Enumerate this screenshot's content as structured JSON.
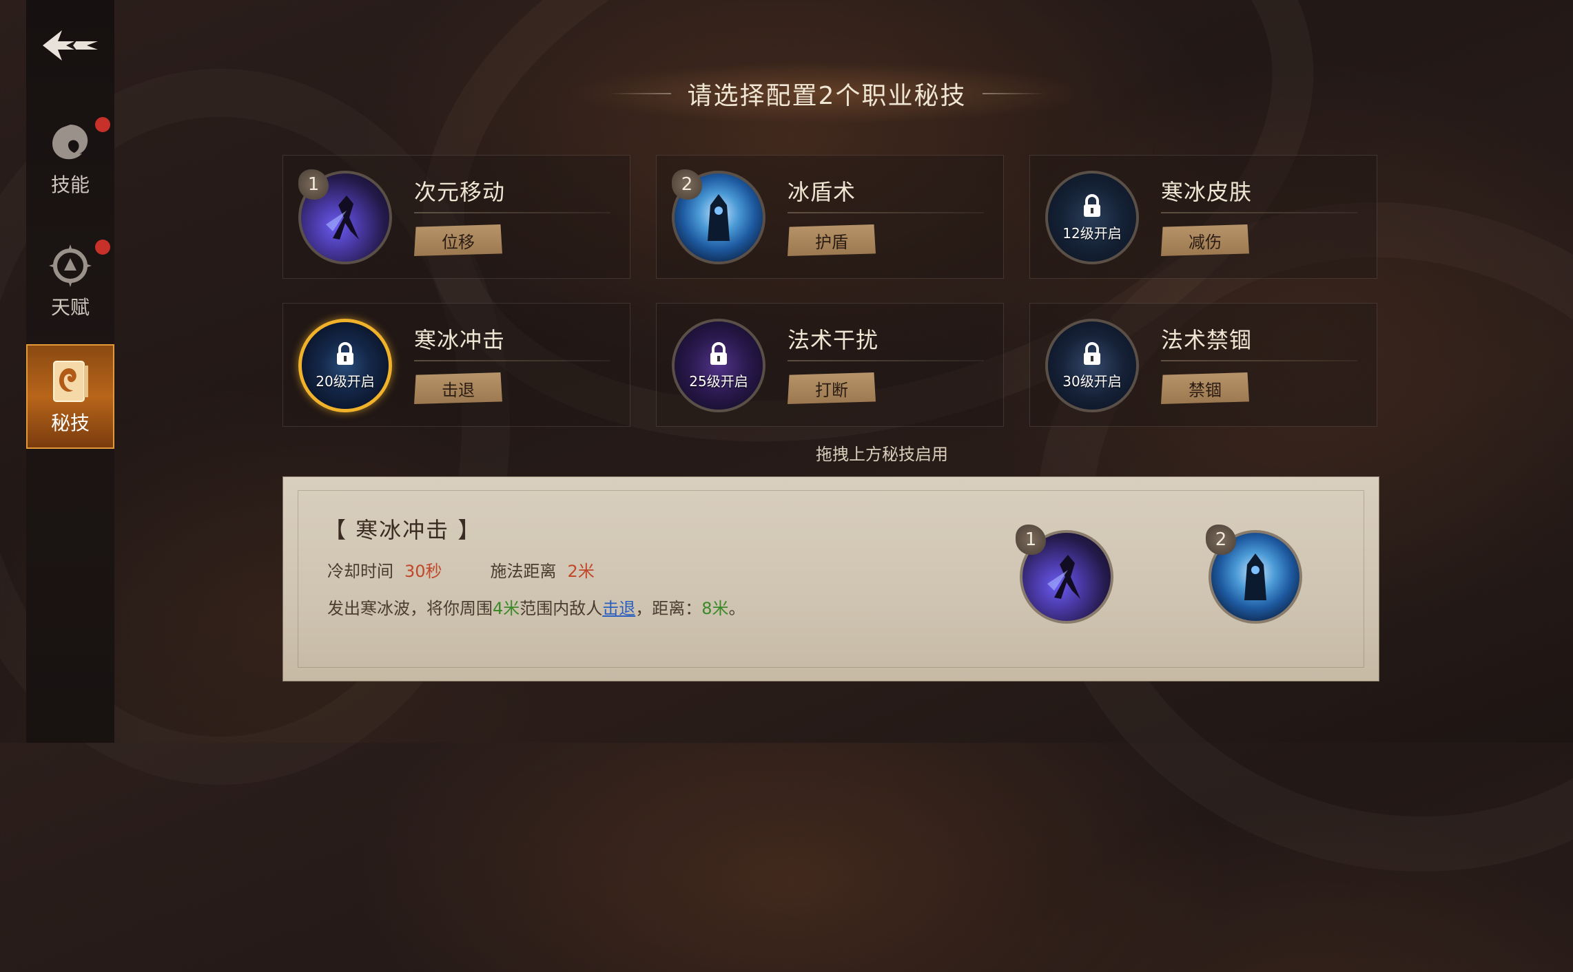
{
  "header": {
    "title": "请选择配置2个职业秘技"
  },
  "sidebar": {
    "items": [
      {
        "label": "技能",
        "has_dot": true
      },
      {
        "label": "天赋",
        "has_dot": true
      },
      {
        "label": "秘技",
        "active": true
      }
    ]
  },
  "skills": [
    {
      "name": "次元移动",
      "tag": "位移",
      "slot": "1",
      "locked": false
    },
    {
      "name": "冰盾术",
      "tag": "护盾",
      "slot": "2",
      "locked": false
    },
    {
      "name": "寒冰皮肤",
      "tag": "减伤",
      "locked": true,
      "unlock": "12级开启"
    },
    {
      "name": "寒冰冲击",
      "tag": "击退",
      "locked": true,
      "unlock": "20级开启",
      "selected": true
    },
    {
      "name": "法术干扰",
      "tag": "打断",
      "locked": true,
      "unlock": "25级开启"
    },
    {
      "name": "法术禁锢",
      "tag": "禁锢",
      "locked": true,
      "unlock": "30级开启"
    }
  ],
  "hint": "拖拽上方秘技启用",
  "detail": {
    "title": "【 寒冰冲击 】",
    "cooldown_label": "冷却时间",
    "cooldown_value": "30秒",
    "range_label": "施法距离",
    "range_value": "2米",
    "desc_part1": "发出寒冰波，将你周围",
    "desc_num1": "4米",
    "desc_part2": "范围内敌人",
    "desc_link": "击退",
    "desc_part3": "，距离：",
    "desc_num2": "8米",
    "desc_part4": "。"
  },
  "equipped_slots": [
    "1",
    "2"
  ],
  "colors": {
    "accent_gold": "#f0b22a",
    "red_dot": "#c8302a",
    "tag_bg": "#b8946a"
  }
}
